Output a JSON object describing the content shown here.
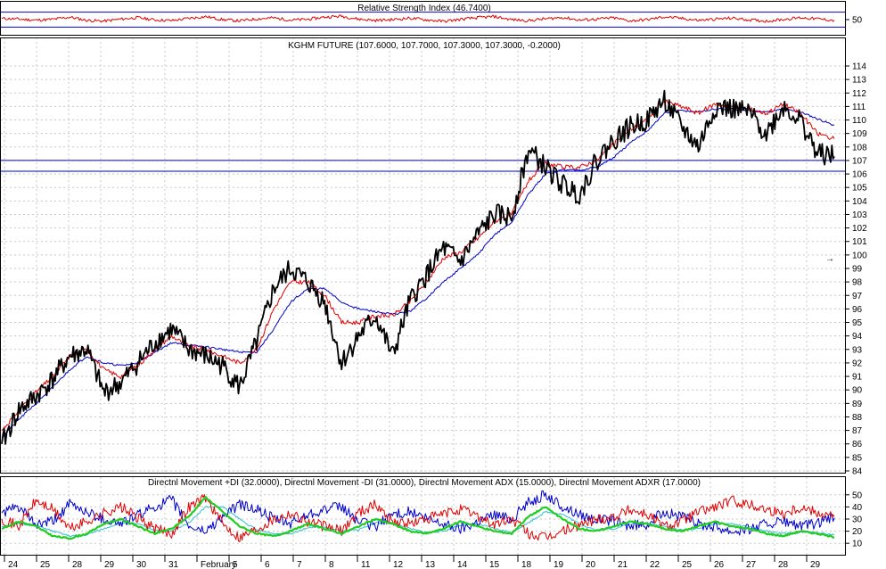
{
  "colors": {
    "background": "#ffffff",
    "panel_border": "#000000",
    "grid": "#c8c8c8",
    "price": "#000000",
    "ma_red": "#e00000",
    "ma_blue": "#0000c8",
    "level_line": "#0000c8",
    "rsi": "#e00000",
    "plus_di": "#e00000",
    "minus_di": "#0000c8",
    "adx": "#22cc22",
    "adxr": "#33c0d0",
    "marker": "#0000ff"
  },
  "chart_data": [
    {
      "type": "line",
      "panel": "rsi",
      "title": "Relative Strength Index (46.7400)",
      "yticks": [
        "50"
      ],
      "ylim": [
        0,
        100
      ],
      "levels": [
        80,
        20
      ],
      "series": [
        {
          "name": "Relative Strength Index",
          "color": "#e00000",
          "values": [
            55,
            52,
            48,
            51,
            60,
            47,
            44,
            52,
            58,
            49,
            46,
            55,
            62,
            50,
            45,
            53,
            57,
            48,
            51,
            60,
            64,
            52,
            47,
            50,
            56,
            49,
            43,
            51,
            58,
            62,
            50,
            46,
            53,
            59,
            48,
            52,
            57,
            45,
            50,
            61,
            55,
            47,
            52,
            56,
            49,
            44,
            51,
            58,
            53,
            47
          ]
        }
      ]
    },
    {
      "type": "line",
      "panel": "price",
      "title": "KGHM FUTURE (107.6000, 107.7000, 107.3000, 107.3000, -0.2000)",
      "ylim": [
        84,
        114
      ],
      "yticks": [
        "84",
        "85",
        "86",
        "87",
        "88",
        "89",
        "90",
        "91",
        "92",
        "93",
        "94",
        "95",
        "96",
        "97",
        "98",
        "99",
        "100",
        "101",
        "102",
        "103",
        "104",
        "105",
        "106",
        "107",
        "108",
        "109",
        "110",
        "111",
        "112",
        "113",
        "114"
      ],
      "levels": [
        107.0,
        106.2
      ],
      "categories": [
        "24",
        "25",
        "28",
        "29",
        "30",
        "31",
        "February",
        "5",
        "6",
        "7",
        "8",
        "11",
        "12",
        "13",
        "14",
        "15",
        "18",
        "19",
        "20",
        "21",
        "22",
        "25",
        "26",
        "27",
        "28",
        "29"
      ],
      "series": [
        {
          "name": "KGHM FUTURE",
          "color": "#000000",
          "values": [
            86.0,
            88.5,
            89.5,
            90.8,
            92.5,
            93.0,
            89.8,
            90.5,
            92.0,
            93.5,
            94.5,
            93.0,
            92.5,
            91.8,
            90.2,
            93.5,
            97.5,
            99.0,
            98.0,
            96.5,
            92.0,
            94.0,
            95.5,
            92.5,
            96.5,
            98.5,
            100.5,
            99.5,
            101.5,
            103.0,
            102.8,
            107.8,
            106.5,
            105.2,
            104.5,
            107.0,
            108.5,
            109.5,
            110.0,
            111.5,
            109.5,
            108.0,
            111.0,
            110.8,
            110.5,
            109.0,
            111.0,
            110.0,
            107.5,
            107.3
          ]
        },
        {
          "name": "Moving Average (red)",
          "color": "#e00000",
          "values": [
            87.0,
            88.5,
            89.8,
            91.0,
            92.5,
            93.0,
            91.5,
            91.0,
            91.8,
            93.0,
            94.0,
            93.2,
            93.0,
            92.5,
            92.0,
            93.0,
            96.0,
            98.0,
            98.0,
            97.0,
            95.0,
            95.0,
            95.5,
            95.5,
            96.5,
            98.0,
            99.8,
            100.2,
            101.2,
            102.5,
            103.0,
            105.5,
            106.8,
            106.5,
            106.5,
            107.0,
            108.2,
            109.3,
            110.0,
            111.4,
            111.0,
            110.5,
            111.2,
            111.0,
            110.8,
            110.5,
            111.2,
            110.5,
            109.0,
            108.6
          ]
        },
        {
          "name": "Moving Average (blue)",
          "color": "#0000c8",
          "values": [
            86.5,
            87.8,
            89.0,
            90.2,
            91.5,
            92.5,
            92.0,
            91.8,
            92.0,
            92.8,
            93.5,
            93.3,
            93.2,
            93.0,
            92.8,
            92.8,
            94.5,
            96.5,
            97.5,
            97.5,
            96.5,
            96.0,
            95.8,
            95.6,
            95.8,
            96.8,
            98.0,
            99.0,
            100.0,
            101.5,
            102.4,
            104.5,
            106.0,
            106.3,
            106.3,
            106.5,
            107.2,
            108.3,
            109.2,
            110.5,
            110.7,
            110.6,
            110.8,
            110.8,
            110.7,
            110.6,
            110.8,
            110.6,
            110.1,
            109.6
          ]
        }
      ],
      "marker": {
        "value": 99.8,
        "symbol": "→"
      }
    },
    {
      "type": "line",
      "panel": "dmi",
      "title": "Directnl Movement +DI (32.0000), Directnl Movement -DI (31.0000), Directnl Movement ADX (15.0000), Directnl Movement ADXR (17.0000)",
      "ylim": [
        5,
        55
      ],
      "yticks": [
        "10",
        "20",
        "30",
        "40",
        "50"
      ],
      "series": [
        {
          "name": "Directnl Movement +DI",
          "color": "#e00000",
          "values": [
            30,
            24,
            45,
            38,
            22,
            28,
            35,
            40,
            31,
            22,
            18,
            40,
            48,
            26,
            15,
            22,
            30,
            35,
            28,
            24,
            20,
            36,
            42,
            28,
            26,
            30,
            34,
            38,
            33,
            25,
            30,
            18,
            14,
            20,
            25,
            30,
            32,
            38,
            34,
            24,
            28,
            36,
            40,
            45,
            42,
            38,
            35,
            40,
            36,
            32
          ]
        },
        {
          "name": "Directnl Movement -DI",
          "color": "#0000c8",
          "values": [
            35,
            40,
            25,
            28,
            42,
            36,
            30,
            26,
            33,
            40,
            46,
            24,
            20,
            32,
            42,
            38,
            30,
            26,
            34,
            38,
            40,
            28,
            24,
            34,
            36,
            30,
            26,
            22,
            28,
            34,
            30,
            44,
            50,
            40,
            34,
            30,
            28,
            24,
            26,
            36,
            32,
            26,
            24,
            20,
            22,
            26,
            28,
            24,
            26,
            31
          ]
        },
        {
          "name": "Directnl Movement ADX",
          "color": "#22cc22",
          "values": [
            22,
            28,
            24,
            16,
            14,
            18,
            26,
            30,
            24,
            18,
            22,
            32,
            48,
            36,
            24,
            18,
            16,
            20,
            26,
            22,
            18,
            24,
            30,
            26,
            20,
            18,
            22,
            28,
            24,
            20,
            18,
            32,
            40,
            30,
            22,
            20,
            24,
            28,
            26,
            22,
            20,
            24,
            28,
            24,
            22,
            18,
            16,
            20,
            18,
            15
          ]
        },
        {
          "name": "Directnl Movement ADXR",
          "color": "#33c0d0",
          "values": [
            24,
            26,
            25,
            20,
            16,
            17,
            22,
            27,
            26,
            21,
            20,
            27,
            40,
            40,
            30,
            21,
            18,
            18,
            23,
            23,
            20,
            21,
            27,
            27,
            22,
            19,
            20,
            25,
            26,
            22,
            19,
            27,
            36,
            34,
            26,
            21,
            22,
            26,
            27,
            24,
            21,
            22,
            26,
            26,
            23,
            20,
            18,
            19,
            19,
            17
          ]
        }
      ]
    }
  ]
}
